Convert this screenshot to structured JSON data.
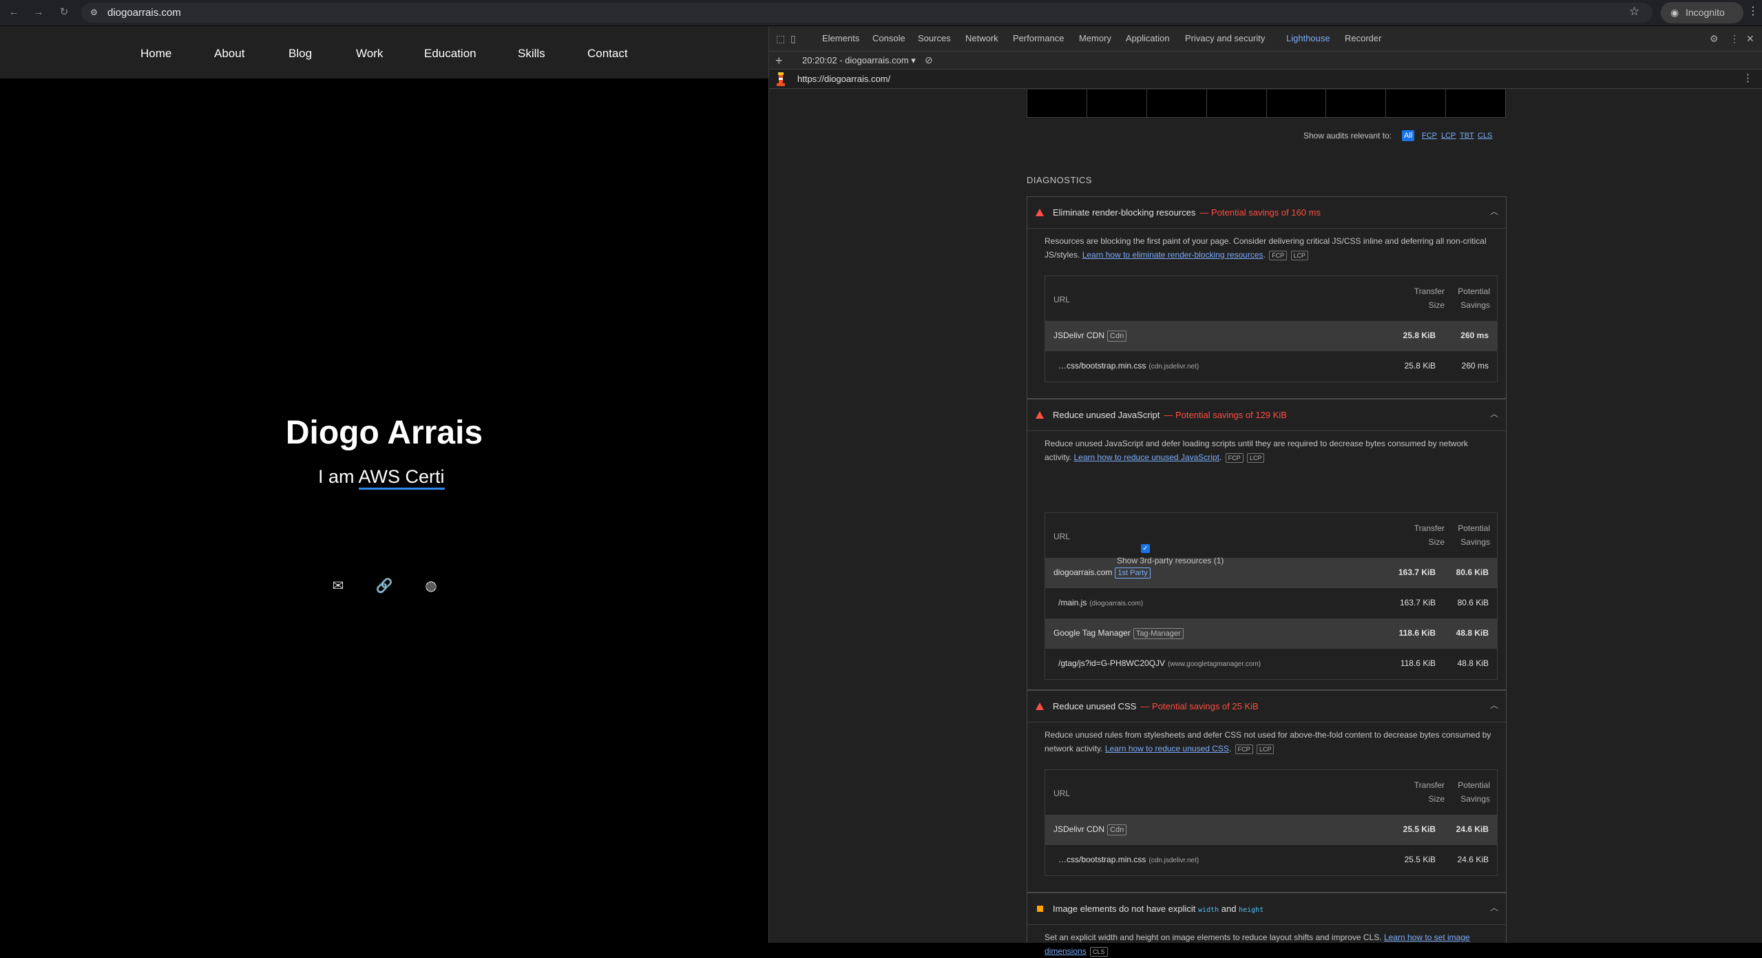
{
  "browser": {
    "url": "diogoarrais.com",
    "incognito_label": "Incognito"
  },
  "site": {
    "nav": [
      "Home",
      "About",
      "Blog",
      "Work",
      "Education",
      "Skills",
      "Contact"
    ],
    "name": "Diogo Arrais",
    "subtitle_prefix": "I am",
    "subtitle_typed": "AWS Certi"
  },
  "devtools": {
    "tabs": [
      "Elements",
      "Console",
      "Sources",
      "Network",
      "Performance",
      "Memory",
      "Application",
      "Privacy and security",
      "Lighthouse",
      "Recorder"
    ],
    "active_tab": "Lighthouse",
    "report_selector": "20:20:02 - diogoarrais.com",
    "report_url": "https://diogoarrais.com/",
    "filter_label": "Show audits relevant to:",
    "filter_chips": [
      "All",
      "FCP",
      "LCP",
      "TBT",
      "CLS"
    ],
    "section_title": "DIAGNOSTICS",
    "col_url": "URL",
    "col_transfer_1": "Transfer",
    "col_transfer_2": "Size",
    "col_savings_1": "Potential",
    "col_savings_2": "Savings",
    "audit1": {
      "title": "Eliminate render-blocking resources",
      "savings": "— Potential savings of 160 ms",
      "desc": "Resources are blocking the first paint of your page. Consider delivering critical JS/CSS inline and deferring all non-critical JS/styles.",
      "link": "Learn how to eliminate render-blocking resources",
      "tags": [
        "FCP",
        "LCP"
      ],
      "rows": [
        {
          "name": "JSDelivr CDN",
          "tag": "Cdn",
          "size": "25.8 KiB",
          "savings": "260 ms"
        },
        {
          "name": "…css/bootstrap.min.css",
          "host": "(cdn.jsdelivr.net)",
          "size": "25.8 KiB",
          "savings": "260 ms"
        }
      ]
    },
    "audit2": {
      "title": "Reduce unused JavaScript",
      "savings": "— Potential savings of 129 KiB",
      "desc": "Reduce unused JavaScript and defer loading scripts until they are required to decrease bytes consumed by network activity.",
      "link": "Learn how to reduce unused JavaScript",
      "tags": [
        "FCP",
        "LCP"
      ],
      "checkbox_label": "Show 3rd-party resources (1)",
      "rows": [
        {
          "name": "diogoarrais.com",
          "tag": "1st Party",
          "size": "163.7 KiB",
          "savings": "80.6 KiB"
        },
        {
          "name": "/main.js",
          "host": "(diogoarrais.com)",
          "size": "163.7 KiB",
          "savings": "80.6 KiB"
        },
        {
          "name": "Google Tag Manager",
          "tag": "Tag-Manager",
          "size": "118.6 KiB",
          "savings": "48.8 KiB"
        },
        {
          "name": "/gtag/js?id=G-PH8WC20QJV",
          "host": "(www.googletagmanager.com)",
          "size": "118.6 KiB",
          "savings": "48.8 KiB"
        }
      ]
    },
    "audit3": {
      "title": "Reduce unused CSS",
      "savings": "— Potential savings of 25 KiB",
      "desc": "Reduce unused rules from stylesheets and defer CSS not used for above-the-fold content to decrease bytes consumed by network activity.",
      "link": "Learn how to reduce unused CSS",
      "tags": [
        "FCP",
        "LCP"
      ],
      "rows": [
        {
          "name": "JSDelivr CDN",
          "tag": "Cdn",
          "size": "25.5 KiB",
          "savings": "24.6 KiB"
        },
        {
          "name": "…css/bootstrap.min.css",
          "host": "(cdn.jsdelivr.net)",
          "size": "25.5 KiB",
          "savings": "24.6 KiB"
        }
      ]
    },
    "audit4": {
      "title_prefix": "Image elements do not have explicit",
      "code1": "width",
      "and": "and",
      "code2": "height",
      "desc": "Set an explicit width and height on image elements to reduce layout shifts and improve CLS.",
      "link": "Learn how to set image dimensions",
      "tag": "CLS"
    }
  }
}
